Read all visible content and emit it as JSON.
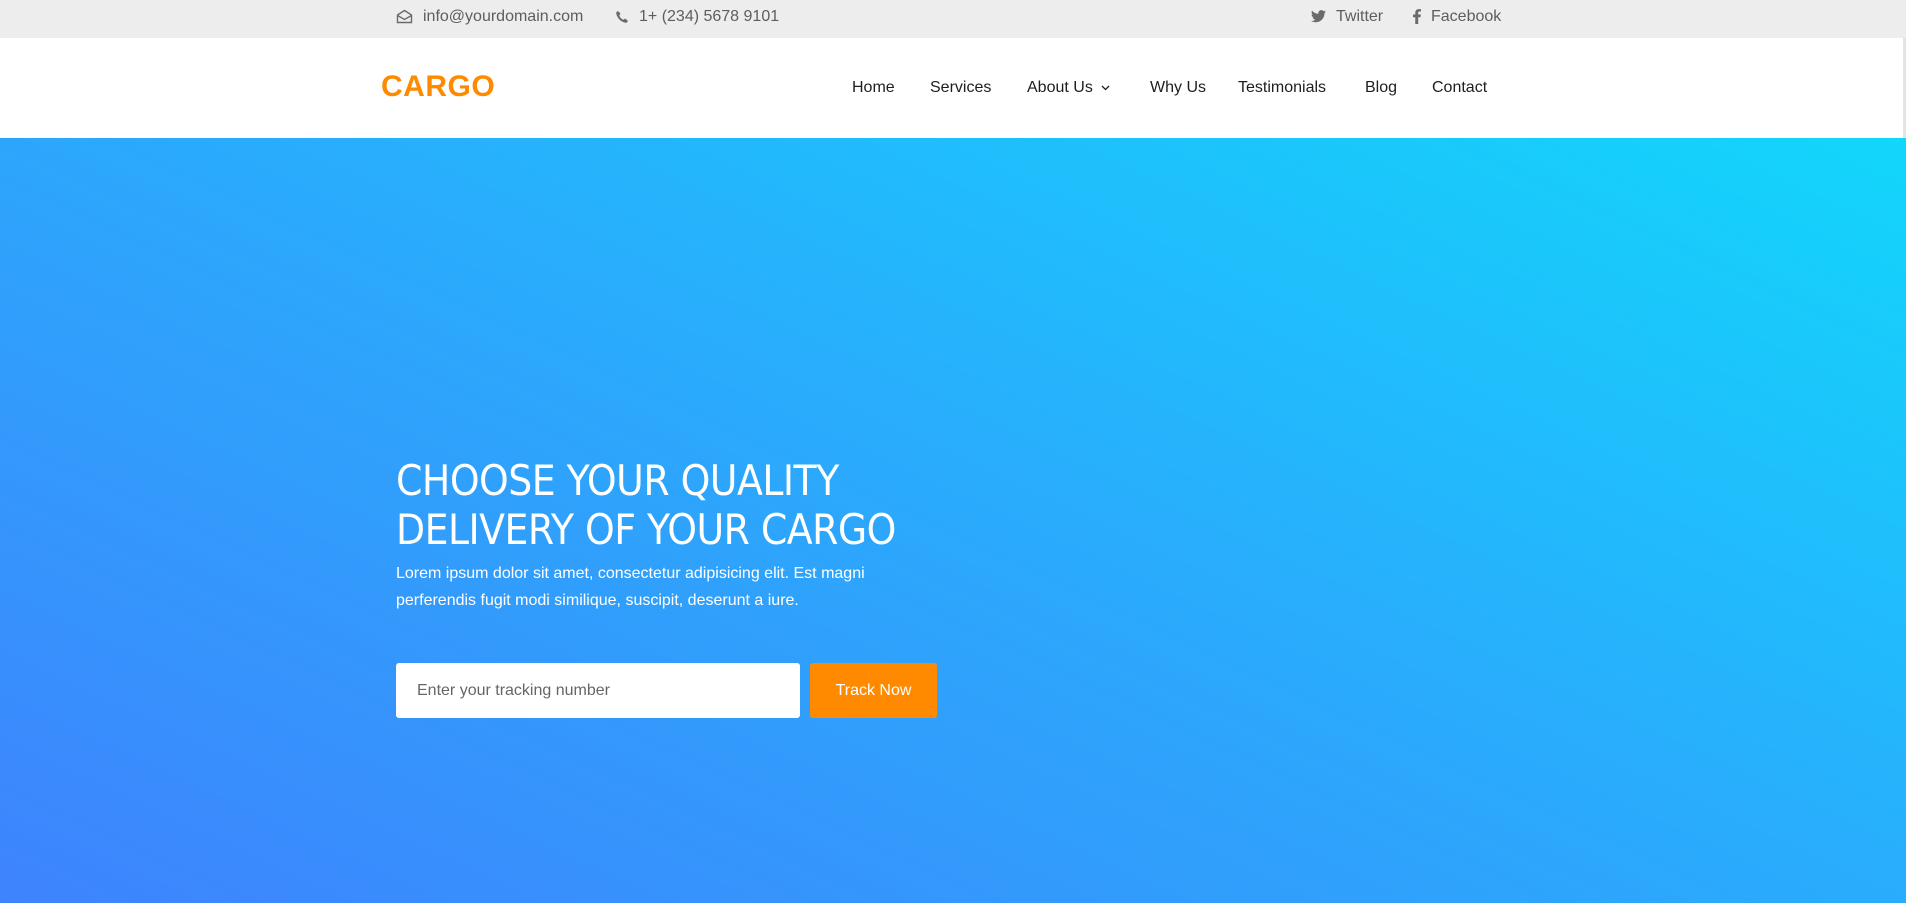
{
  "topbar": {
    "email": {
      "icon": "envelope-icon",
      "text": "info@yourdomain.com"
    },
    "phone": {
      "icon": "phone-icon",
      "text": "1+ (234) 5678 9101"
    },
    "twitter": {
      "icon": "twitter-icon",
      "text": "Twitter"
    },
    "facebook": {
      "icon": "facebook-icon",
      "text": "Facebook"
    }
  },
  "header": {
    "logo": "CARGO",
    "nav": [
      {
        "label": "Home"
      },
      {
        "label": "Services"
      },
      {
        "label": "About Us",
        "icon": "chevron-down-icon"
      },
      {
        "label": "Why Us"
      },
      {
        "label": "Testimonials"
      },
      {
        "label": "Blog"
      },
      {
        "label": "Contact"
      }
    ]
  },
  "hero": {
    "title": "CHOOSE YOUR QUALITY DELIVERY OF YOUR CARGO",
    "text": "Lorem ipsum dolor sit amet, consectetur adipisicing elit. Est magni perferendis fugit modi similique, suscipit, deserunt a iure.",
    "tracking_placeholder": "Enter your tracking number",
    "track_button": "Track Now"
  },
  "colors": {
    "accent": "#ff8a00",
    "hero_gradient_start": "#3e83fd",
    "hero_gradient_end": "#12d6fb",
    "topbar_bg": "#ededed"
  }
}
